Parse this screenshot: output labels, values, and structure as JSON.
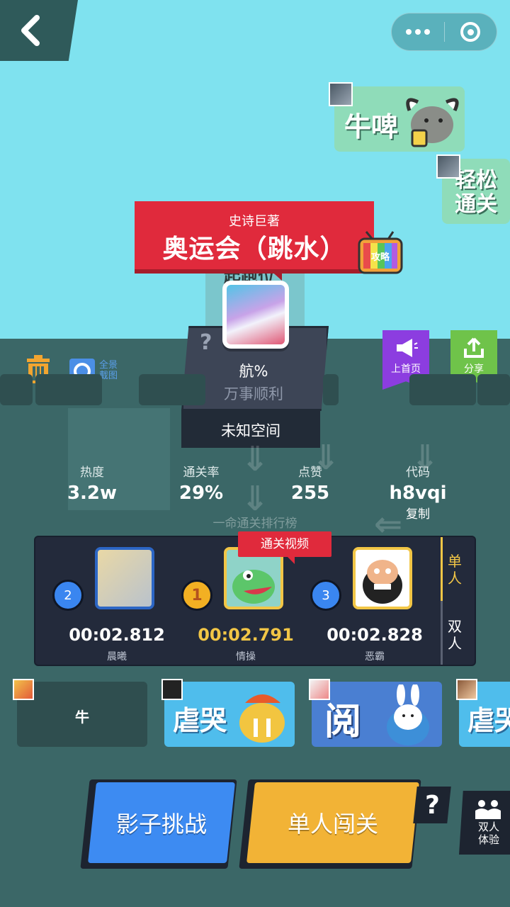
{
  "nav": {
    "back_icon": "chevron-left-icon"
  },
  "capsule": {
    "more_icon": "more-dots-icon",
    "close_icon": "target-circle-icon"
  },
  "sky_cards": [
    {
      "text": "牛啤"
    },
    {
      "text": "轻松通关"
    }
  ],
  "level": {
    "title_sub": "史诗巨著",
    "title_main": "奥运会（跳水）",
    "tv_label": "攻略",
    "start_label": "起跑位",
    "question_mark": "?",
    "pass_pct": "航%",
    "motto": "万事顺利",
    "space": "未知空间"
  },
  "tools": {
    "camera_label": "全景\n截图"
  },
  "flags": {
    "home_label": "上首页",
    "share_label": "分享"
  },
  "stats": {
    "heat_label": "热度",
    "heat_value": "3.2w",
    "rate_label": "通关率",
    "rate_value": "29%",
    "like_label": "点赞",
    "like_value": "255",
    "code_label": "代码",
    "code_value": "h8vqi",
    "copy_label": "复制"
  },
  "leaderboard": {
    "title": "一命通关排行榜",
    "video_tag": "通关视频",
    "entries": [
      {
        "rank": "2",
        "time": "00:02.812",
        "name": "晨曦"
      },
      {
        "rank": "1",
        "time": "00:02.791",
        "name": "情操"
      },
      {
        "rank": "3",
        "time": "00:02.828",
        "name": "恶霸"
      }
    ],
    "tab_single": "单人",
    "tab_double": "双人"
  },
  "tags": [
    {
      "text": "牛"
    },
    {
      "text": "虐哭"
    },
    {
      "text": "阅"
    },
    {
      "text": "虐哭"
    }
  ],
  "buttons": {
    "shadow_challenge": "影子挑战",
    "single_play": "单人闯关",
    "help": "?",
    "duo_label": "双人\n体验"
  },
  "colors": {
    "sky": "#7fe2ef",
    "ground": "#3b6767",
    "banner_red": "#e02a3c",
    "gold": "#f2c646",
    "blue_btn": "#3d8bf2",
    "yellow_btn": "#f2b336"
  }
}
